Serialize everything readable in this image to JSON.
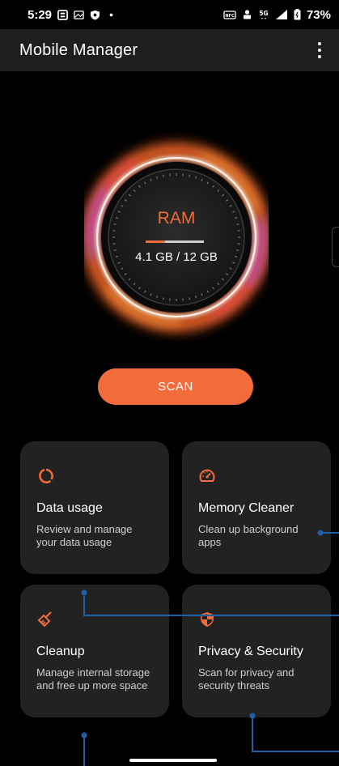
{
  "status": {
    "time": "5:29",
    "battery": "73%"
  },
  "appbar": {
    "title": "Mobile Manager"
  },
  "ram": {
    "label": "RAM",
    "value": "4.1 GB / 12 GB",
    "used_fraction": 0.34
  },
  "scan": {
    "label": "SCAN"
  },
  "cards": [
    {
      "title": "Data usage",
      "desc": "Review and manage your data usage",
      "icon": "data-usage-icon"
    },
    {
      "title": "Memory Cleaner",
      "desc": "Clean up background apps",
      "icon": "speedometer-icon"
    },
    {
      "title": "Cleanup",
      "desc": "Manage internal storage and free up more space",
      "icon": "broom-icon"
    },
    {
      "title": "Privacy & Security",
      "desc": "Scan for privacy and security threats",
      "icon": "shield-icon"
    }
  ],
  "colors": {
    "accent": "#f26b3a",
    "card_bg": "#222222",
    "annotation_line": "#1f5fa8"
  }
}
